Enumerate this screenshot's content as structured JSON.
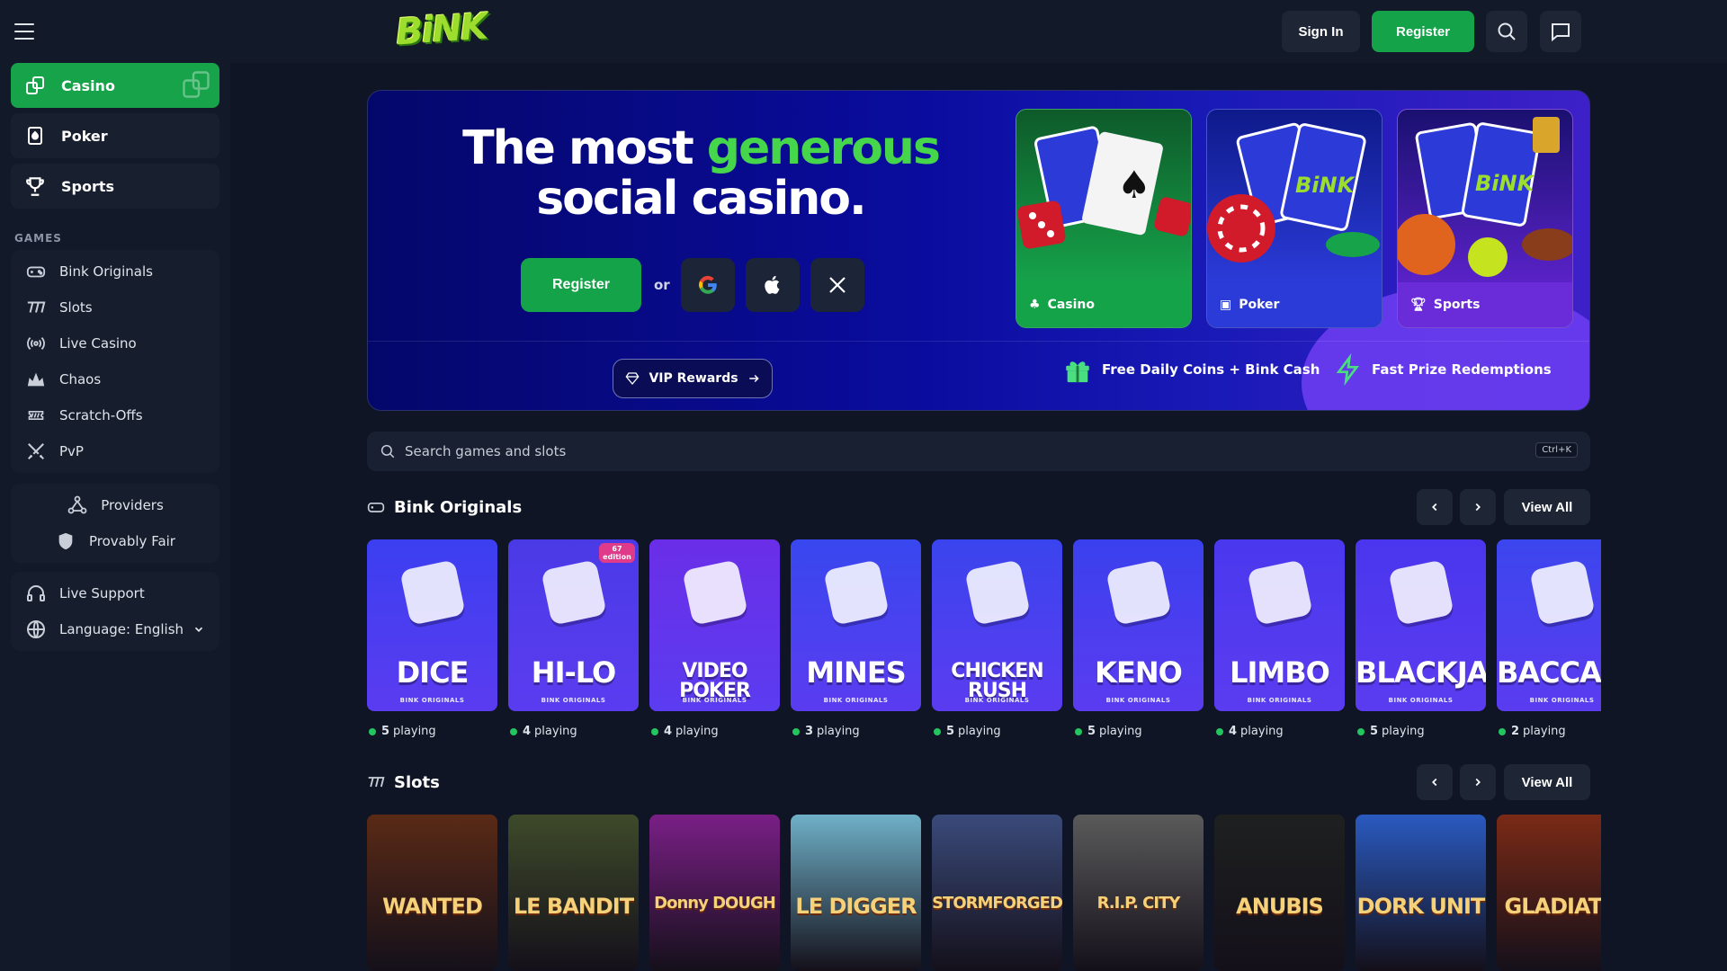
{
  "brand": {
    "logo_text": "BiNK"
  },
  "header": {
    "signin_label": "Sign In",
    "register_label": "Register"
  },
  "sidebar": {
    "main": [
      {
        "label": "Casino",
        "icon": "casino-icon",
        "active": true
      },
      {
        "label": "Poker",
        "icon": "poker-icon",
        "active": false
      },
      {
        "label": "Sports",
        "icon": "trophy-icon",
        "active": false
      }
    ],
    "games_heading": "GAMES",
    "games": [
      {
        "label": "Bink Originals",
        "icon": "gamepad-icon"
      },
      {
        "label": "Slots",
        "icon": "slots-icon"
      },
      {
        "label": "Live Casino",
        "icon": "broadcast-icon"
      },
      {
        "label": "Chaos",
        "icon": "crown-icon"
      },
      {
        "label": "Scratch-Offs",
        "icon": "ticket-icon"
      },
      {
        "label": "PvP",
        "icon": "swords-icon"
      }
    ],
    "extras": [
      {
        "label": "Providers",
        "icon": "providers-icon"
      },
      {
        "label": "Provably Fair",
        "icon": "shield-icon"
      }
    ],
    "support": {
      "label": "Live Support",
      "icon": "headset-icon"
    },
    "language": {
      "label": "Language: English",
      "icon": "globe-icon"
    }
  },
  "hero": {
    "title_part1": "The most ",
    "title_highlight": "generous",
    "title_part2": "social casino.",
    "register_label": "Register",
    "or_label": "or",
    "vip_label": "VIP Rewards",
    "perk1": "Free Daily Coins + Bink Cash",
    "perk2": "Fast Prize Redemptions",
    "cards": [
      {
        "label": "Casino",
        "icon": "club-icon",
        "color": "#16a34a"
      },
      {
        "label": "Poker",
        "icon": "poker-chip-icon",
        "color": "#2b3bd8"
      },
      {
        "label": "Sports",
        "icon": "trophy-icon",
        "color": "#6a2bd8"
      }
    ]
  },
  "search": {
    "placeholder": "Search games and slots",
    "shortcut": "Ctrl+K"
  },
  "originals": {
    "title": "Bink Originals",
    "view_all": "View All",
    "games": [
      {
        "name": "DICE",
        "sub": "BINK ORIGINALS",
        "players": "5",
        "color": "#3b3ff0"
      },
      {
        "name": "HI-LO",
        "sub": "BINK ORIGINALS",
        "players": "4",
        "color": "#4a3ae6",
        "badge": "67 edition"
      },
      {
        "name": "VIDEO POKER",
        "sub": "BINK ORIGINALS",
        "players": "4",
        "color": "#6a2ee8"
      },
      {
        "name": "MINES",
        "sub": "BINK ORIGINALS",
        "players": "3",
        "color": "#3847ef"
      },
      {
        "name": "CHICKEN RUSH",
        "sub": "BINK ORIGINALS",
        "players": "5",
        "color": "#3a44ee"
      },
      {
        "name": "KENO",
        "sub": "BINK ORIGINALS",
        "players": "5",
        "color": "#3a40ee"
      },
      {
        "name": "LIMBO",
        "sub": "BINK ORIGINALS",
        "players": "4",
        "color": "#4a38ee"
      },
      {
        "name": "BLACKJACK",
        "sub": "BINK ORIGINALS",
        "players": "5",
        "color": "#4a36ee"
      },
      {
        "name": "BACCARA",
        "sub": "BINK ORIGINALS",
        "players": "2",
        "color": "#3c46ee"
      }
    ],
    "playing_label": "playing"
  },
  "slots": {
    "title": "Slots",
    "view_all": "View All",
    "games": [
      {
        "name": "WANTED",
        "color": "#5a2a16"
      },
      {
        "name": "LE BANDIT",
        "color": "#3e4a2a"
      },
      {
        "name": "Donny DOUGH",
        "color": "#7a1f86"
      },
      {
        "name": "LE DIGGER",
        "color": "#6fb0c8"
      },
      {
        "name": "STORMFORGED",
        "color": "#3a4a7a"
      },
      {
        "name": "R.I.P. CITY",
        "color": "#5a5a5a"
      },
      {
        "name": "ANUBIS",
        "color": "#1e2020"
      },
      {
        "name": "DORK UNIT",
        "color": "#2a5ac0"
      },
      {
        "name": "GLADIATO",
        "color": "#7a2a16"
      }
    ]
  }
}
